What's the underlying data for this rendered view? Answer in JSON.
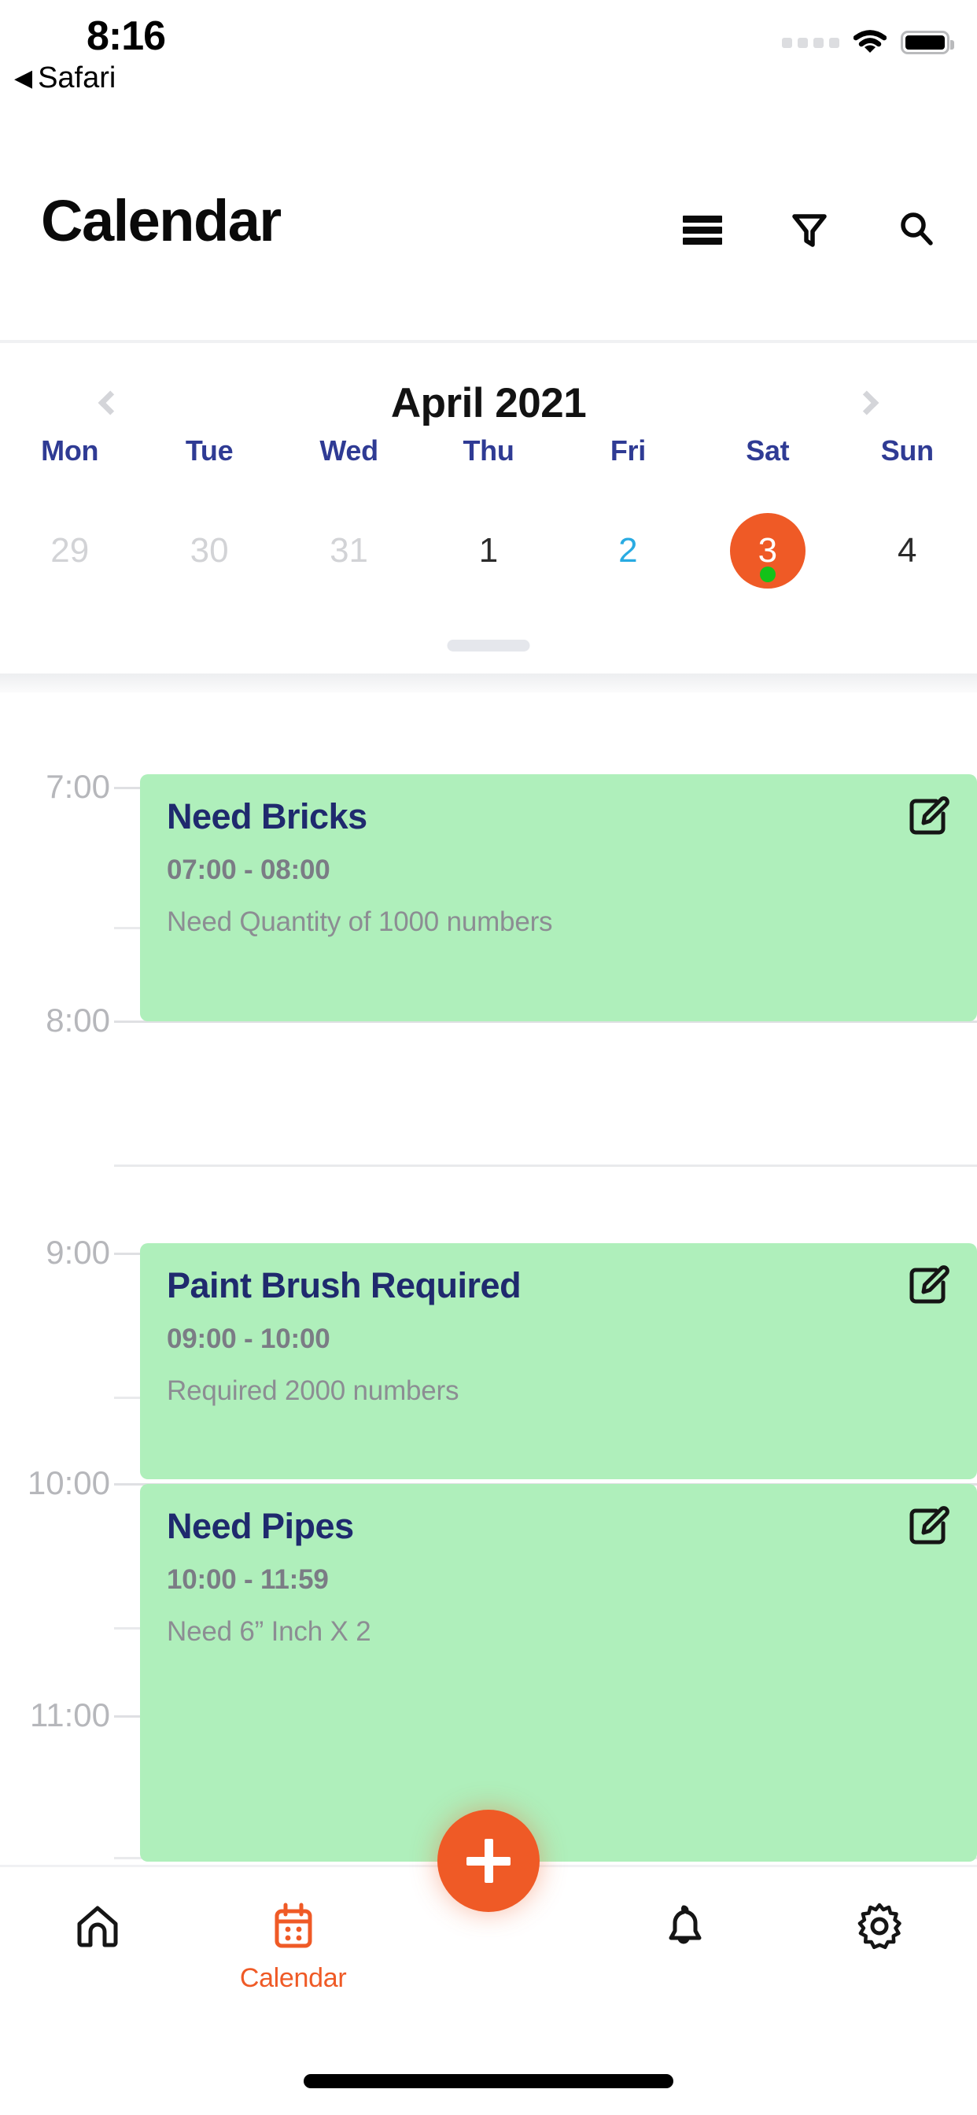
{
  "status_bar": {
    "time": "8:16",
    "back_label": "Safari",
    "back_arrow_glyph": "◀",
    "icons": [
      "signal-dots",
      "wifi-icon",
      "battery-icon"
    ]
  },
  "header": {
    "title": "Calendar",
    "actions": [
      {
        "name": "menu-icon",
        "label": "Menu"
      },
      {
        "name": "filter-icon",
        "label": "Filter"
      },
      {
        "name": "search-icon",
        "label": "Search"
      }
    ]
  },
  "calendar_strip": {
    "month_label": "April 2021",
    "prev_label": "Previous month",
    "next_label": "Next month",
    "weekdays": [
      "Mon",
      "Tue",
      "Wed",
      "Thu",
      "Fri",
      "Sat",
      "Sun"
    ],
    "days": [
      {
        "num": "29",
        "state": "muted"
      },
      {
        "num": "30",
        "state": "muted"
      },
      {
        "num": "31",
        "state": "muted"
      },
      {
        "num": "1",
        "state": "normal"
      },
      {
        "num": "2",
        "state": "cyan"
      },
      {
        "num": "3",
        "state": "selected",
        "has_event_dot": true
      },
      {
        "num": "4",
        "state": "normal"
      }
    ]
  },
  "agenda": {
    "hour_labels": [
      "7:00",
      "8:00",
      "9:00",
      "10:00",
      "11:00"
    ],
    "events": [
      {
        "title": "Need Bricks",
        "time": "07:00 - 08:00",
        "description": "Need Quantity of 1000 numbers",
        "edit_label": "Edit event"
      },
      {
        "title": "Paint Brush Required",
        "time": "09:00 - 10:00",
        "description": "Required 2000 numbers",
        "edit_label": "Edit event"
      },
      {
        "title": "Need Pipes",
        "time": "10:00 - 11:59",
        "description": "Need 6” Inch X 2",
        "edit_label": "Edit event"
      }
    ]
  },
  "fab": {
    "label": "Add event",
    "glyph": "+"
  },
  "tab_bar": {
    "items": [
      {
        "icon": "home-icon",
        "label": "",
        "active": false
      },
      {
        "icon": "calendar-icon",
        "label": "Calendar",
        "active": true
      },
      {
        "icon": "bell-icon",
        "label": "",
        "active": false
      },
      {
        "icon": "gear-icon",
        "label": "",
        "active": false
      }
    ]
  },
  "colors": {
    "accent_orange": "#EF5A26",
    "event_green": "#AFEFBB",
    "weekday_blue": "#2F3B94",
    "event_title_navy": "#1F2A6E",
    "cyan_date": "#29ABE2",
    "event_dot_green": "#13C219"
  }
}
